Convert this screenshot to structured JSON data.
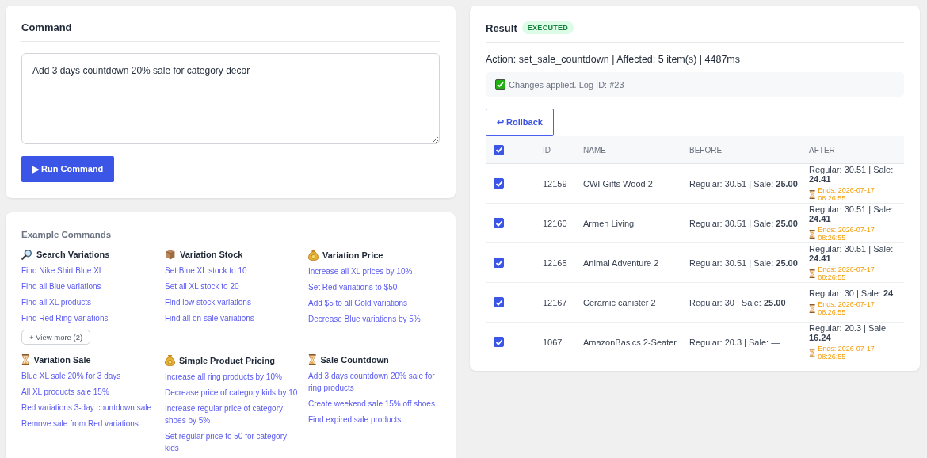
{
  "command": {
    "title": "Command",
    "value": "Add 3 days countdown 20% sale for category decor",
    "run_button": "▶ Run Command"
  },
  "examples": {
    "title": "Example Commands",
    "groups": [
      {
        "kind": "search",
        "title": "Search Variations",
        "items": [
          "Find Nike Shirt Blue XL",
          "Find all Blue variations",
          "Find all XL products",
          "Find Red Ring variations"
        ],
        "more": "+ View more (2)"
      },
      {
        "kind": "box",
        "title": "Variation Stock",
        "items": [
          "Set Blue XL stock to 10",
          "Set all XL stock to 20",
          "Find low stock variations",
          "Find all on sale variations"
        ]
      },
      {
        "kind": "bag",
        "title": "Variation Price",
        "items": [
          "Increase all XL prices by 10%",
          "Set Red variations to $50",
          "Add $5 to all Gold variations",
          "Decrease Blue variations by 5%"
        ]
      },
      {
        "kind": "hourglass",
        "title": "Variation Sale",
        "items": [
          "Blue XL sale 20% for 3 days",
          "All XL products sale 15%",
          "Red variations 3-day countdown sale",
          "Remove sale from Red variations"
        ]
      },
      {
        "kind": "bag",
        "title": "Simple Product Pricing",
        "items": [
          "Increase all ring products by 10%",
          "Decrease price of category kids by 10",
          "Increase regular price of category shoes by 5%",
          "Set regular price to 50 for category kids"
        ]
      },
      {
        "kind": "hourglass",
        "title": "Sale Countdown",
        "items": [
          "Add 3 days countdown 20% sale for ring products",
          "Create weekend sale 15% off shoes",
          "Find expired sale products"
        ]
      }
    ]
  },
  "result": {
    "title": "Result",
    "badge": "EXECUTED",
    "summary": "Action: set_sale_countdown | Affected: 5 item(s) | 4487ms",
    "notice": "Changes applied. Log ID: #23",
    "rollback_button": "↩ Rollback",
    "table": {
      "all_checked": true,
      "columns": [
        "ID",
        "NAME",
        "BEFORE",
        "AFTER"
      ],
      "rows": [
        {
          "checked": true,
          "id": "12159",
          "name": "CWI Gifts Wood 2",
          "before": "Regular: 30.51 | Sale: **25.00**",
          "after": "Regular: 30.51 | Sale: **24.41**",
          "ends": "Ends: 2026-07-17 08:26:55"
        },
        {
          "checked": true,
          "id": "12160",
          "name": "Armen Living",
          "before": "Regular: 30.51 | Sale: **25.00**",
          "after": "Regular: 30.51 | Sale: **24.41**",
          "ends": "Ends: 2026-07-17 08:26:55"
        },
        {
          "checked": true,
          "id": "12165",
          "name": "Animal Adventure 2",
          "before": "Regular: 30.51 | Sale: **25.00**",
          "after": "Regular: 30.51 | Sale: **24.41**",
          "ends": "Ends: 2026-07-17 08:26:55"
        },
        {
          "checked": true,
          "id": "12167",
          "name": "Ceramic canister 2",
          "before": "Regular: 30 | Sale: **25.00**",
          "after": "Regular: 30 | Sale: **24**",
          "ends": "Ends: 2026-07-17 08:26:55"
        },
        {
          "checked": true,
          "id": "1067",
          "name": "AmazonBasics 2-Seater",
          "before": "Regular: 20.3 | Sale: —",
          "after": "Regular: 20.3 | Sale: **16.24**",
          "ends": "Ends: 2026-07-17 08:26:55"
        }
      ]
    }
  }
}
